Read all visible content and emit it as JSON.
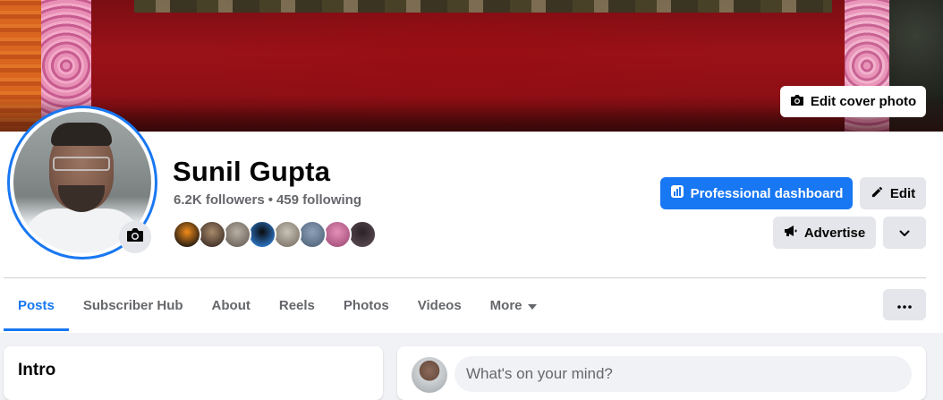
{
  "cover": {
    "edit_label": "Edit cover photo"
  },
  "profile": {
    "name": "Sunil Gupta",
    "followers": "6.2K followers",
    "separator": "•",
    "following": "459 following",
    "friend_avatars": [
      {
        "colors": [
          "#f28c1a",
          "#111111"
        ]
      },
      {
        "colors": [
          "#a98a6a",
          "#3a2c24"
        ]
      },
      {
        "colors": [
          "#b8b0a3",
          "#6a625a"
        ]
      },
      {
        "colors": [
          "#0b0b0b",
          "#2f7fd8"
        ]
      },
      {
        "colors": [
          "#c9c2b8",
          "#7d7468"
        ]
      },
      {
        "colors": [
          "#8da0b8",
          "#50657a"
        ]
      },
      {
        "colors": [
          "#e58fb8",
          "#a34f7a"
        ]
      },
      {
        "colors": [
          "#2b2226",
          "#5b4a52"
        ]
      }
    ]
  },
  "actions": {
    "professional_dashboard": "Professional dashboard",
    "edit": "Edit",
    "advertise": "Advertise"
  },
  "tabs": [
    {
      "label": "Posts",
      "active": true
    },
    {
      "label": "Subscriber Hub",
      "active": false
    },
    {
      "label": "About",
      "active": false
    },
    {
      "label": "Reels",
      "active": false
    },
    {
      "label": "Photos",
      "active": false
    },
    {
      "label": "Videos",
      "active": false
    },
    {
      "label": "More",
      "active": false
    }
  ],
  "intro": {
    "title": "Intro"
  },
  "composer": {
    "placeholder": "What's on your mind?"
  },
  "colors": {
    "accent": "#1877f2",
    "secondary_button": "#e4e6eb",
    "muted_text": "#65676b"
  }
}
